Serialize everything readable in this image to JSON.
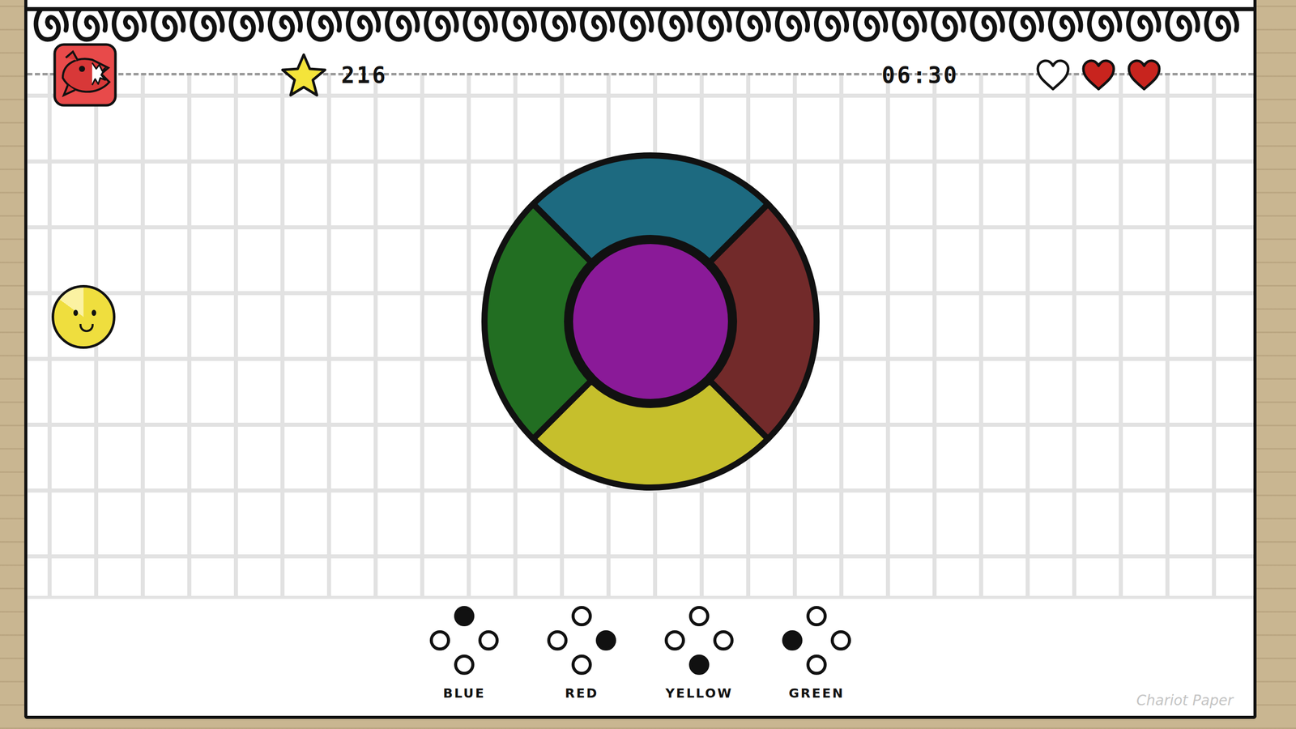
{
  "hud": {
    "score": "216",
    "timer": "06:30",
    "lives": [
      {
        "filled": false
      },
      {
        "filled": true
      },
      {
        "filled": true
      }
    ]
  },
  "player_ball": {
    "level": 0.85
  },
  "wheel": {
    "center": {
      "color": "#8a1a98"
    },
    "segments": [
      {
        "name": "blue",
        "direction": "up",
        "color": "#1d6a80"
      },
      {
        "name": "red",
        "direction": "right",
        "color": "#722a2a"
      },
      {
        "name": "yellow",
        "direction": "down",
        "color": "#c6bf2c"
      },
      {
        "name": "green",
        "direction": "left",
        "color": "#226e22"
      }
    ]
  },
  "controls": [
    {
      "label": "BLUE",
      "direction": "up"
    },
    {
      "label": "RED",
      "direction": "right"
    },
    {
      "label": "YELLOW",
      "direction": "down"
    },
    {
      "label": "GREEN",
      "direction": "left"
    }
  ],
  "watermark": "Chariot Paper"
}
